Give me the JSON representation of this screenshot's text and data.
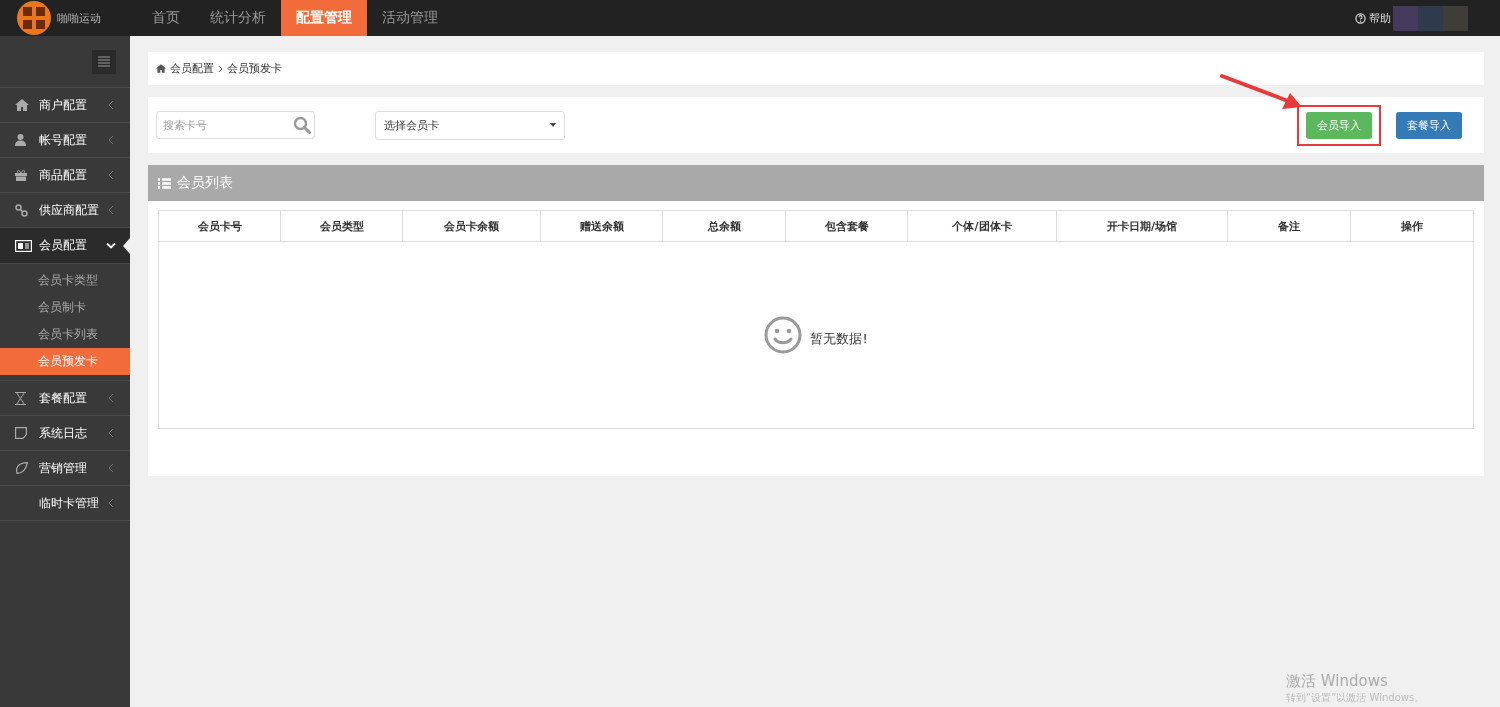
{
  "brand": {
    "name": "啪啪运动"
  },
  "nav_tabs": [
    {
      "label": "首页",
      "selected": false
    },
    {
      "label": "统计分析",
      "selected": false
    },
    {
      "label": "配置管理",
      "selected": true
    },
    {
      "label": "活动管理",
      "selected": false
    }
  ],
  "help": {
    "label": "帮助"
  },
  "sidebar": {
    "items": [
      {
        "label": "商户配置",
        "expanded": false
      },
      {
        "label": "帐号配置",
        "expanded": false
      },
      {
        "label": "商品配置",
        "expanded": false
      },
      {
        "label": "供应商配置",
        "expanded": false
      },
      {
        "label": "会员配置",
        "expanded": true,
        "children": [
          {
            "label": "会员卡类型",
            "selected": false
          },
          {
            "label": "会员制卡",
            "selected": false
          },
          {
            "label": "会员卡列表",
            "selected": false
          },
          {
            "label": "会员预发卡",
            "selected": true
          }
        ]
      },
      {
        "label": "套餐配置",
        "expanded": false
      },
      {
        "label": "系统日志",
        "expanded": false
      },
      {
        "label": "营销管理",
        "expanded": false
      },
      {
        "label": "临时卡管理",
        "expanded": false
      }
    ]
  },
  "breadcrumb": [
    "会员配置",
    "会员预发卡"
  ],
  "toolbar": {
    "search": {
      "placeholder": "搜索卡号"
    },
    "select": {
      "value": "选择会员卡"
    },
    "buttons": [
      {
        "label": "会员导入",
        "kind": "success",
        "highlighted": true
      },
      {
        "label": "套餐导入",
        "kind": "primary",
        "highlighted": false
      }
    ]
  },
  "panel": {
    "title": "会员列表"
  },
  "table": {
    "columns": [
      "会员卡号",
      "会员类型",
      "会员卡余额",
      "赠送余额",
      "总余额",
      "包含套餐",
      "个体/团体卡",
      "开卡日期/场馆",
      "备注",
      "操作"
    ],
    "empty_message": "暂无数据!"
  },
  "os_overlay": {
    "title": "激活 Windows",
    "subtitle": "转到“设置”以激活 Windows。"
  }
}
